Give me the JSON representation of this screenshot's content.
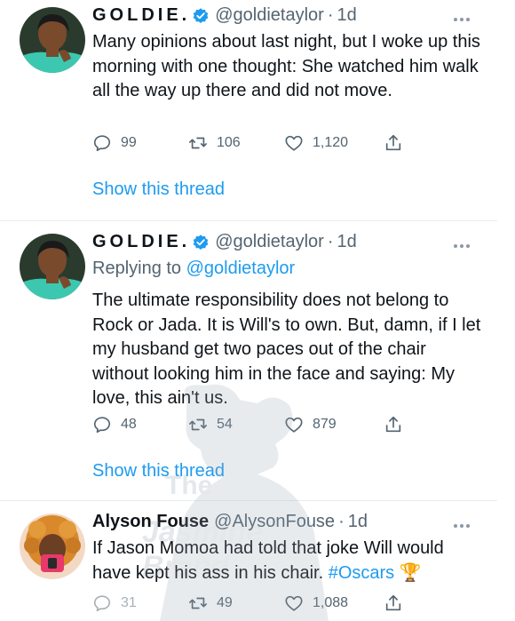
{
  "tweets": [
    {
      "display_name": "GOLDIE.",
      "handle": "@goldietaylor",
      "time": "1d",
      "text": "Many opinions about last night, but I woke up this morning with one thought: She watched him walk all the way up there and did not move.",
      "reply_count": "99",
      "retweet_count": "106",
      "like_count": "1,120",
      "thread_link": "Show this thread"
    },
    {
      "display_name": "GOLDIE.",
      "handle": "@goldietaylor",
      "time": "1d",
      "replying_label": "Replying to",
      "replying_handle": "@goldietaylor",
      "text": "The ultimate responsibility does not belong to Rock or Jada. It is Will's to own. But, damn, if I let my husband get two paces out of the chair without looking him in the face and saying: My love, this ain't us.",
      "reply_count": "48",
      "retweet_count": "54",
      "like_count": "879",
      "thread_link": "Show this thread"
    },
    {
      "display_name": "Alyson Fouse",
      "handle": "@AlysonFouse",
      "time": "1d",
      "text": "If Jason Momoa had told that joke Will would have kept his ass in his chair.",
      "hashtag": "#Oscars",
      "trophy_emoji": "🏆",
      "reply_count": "31",
      "retweet_count": "49",
      "like_count": "1,088"
    }
  ],
  "dot_separator": "·",
  "watermark": {
    "line1": "The",
    "line2": "Jasmine Brand"
  },
  "colors": {
    "link_blue": "#1d9bf0",
    "secondary_text": "#536471",
    "primary_text": "#0f1419",
    "divider": "#e6ecf0",
    "verified_blue": "#1d9bf0"
  },
  "icons": [
    "avatar",
    "verified-badge-icon",
    "more-options-icon",
    "reply-icon",
    "retweet-icon",
    "like-icon",
    "share-icon",
    "trophy-icon"
  ]
}
